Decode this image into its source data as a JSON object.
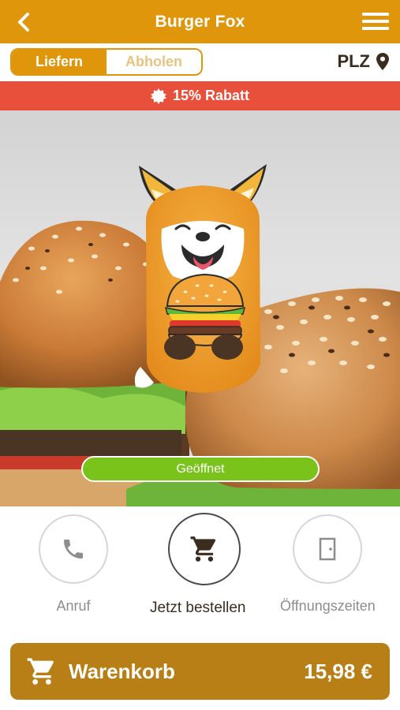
{
  "header": {
    "title": "Burger Fox"
  },
  "mode": {
    "delivery_label": "Liefern",
    "pickup_label": "Abholen",
    "postcode_label": "PLZ"
  },
  "promo": {
    "text": "15% Rabatt"
  },
  "hero": {
    "status_label": "Geöffnet"
  },
  "actions": {
    "call_label": "Anruf",
    "order_label": "Jetzt bestellen",
    "hours_label": "Öffnungszeiten"
  },
  "cart": {
    "label": "Warenkorb",
    "total": "15,98 €"
  },
  "colors": {
    "brand": "#e0960b",
    "promo": "#e8503c",
    "open": "#79c31a",
    "cart": "#b77f16"
  }
}
